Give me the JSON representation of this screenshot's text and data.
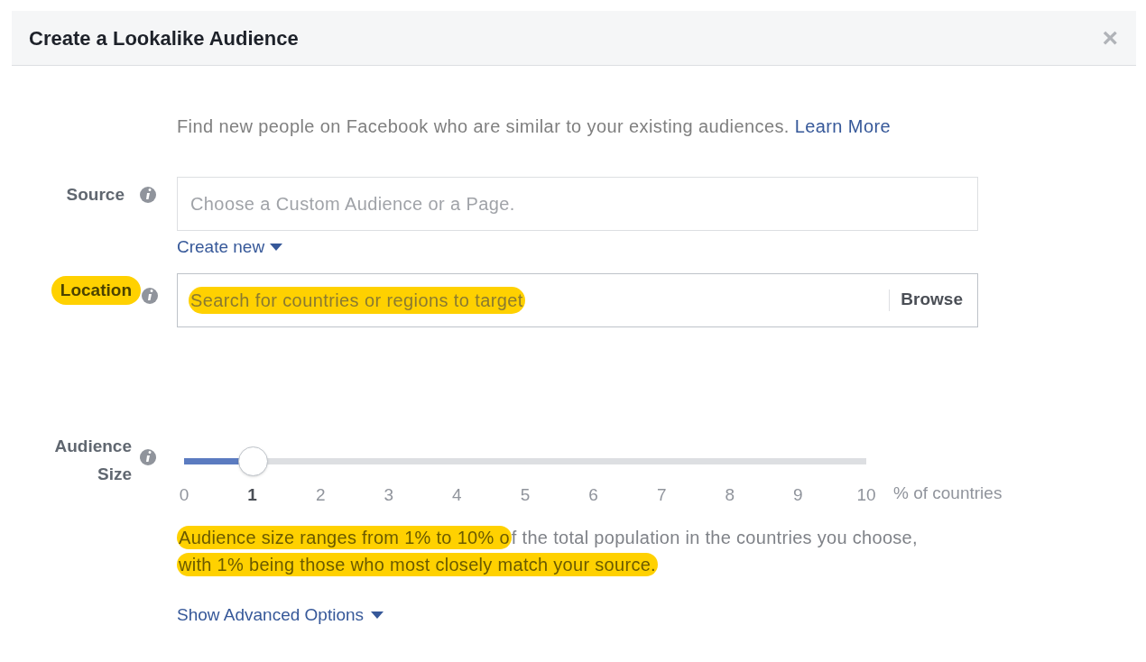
{
  "dialog": {
    "title": "Create a Lookalike Audience",
    "close": "×"
  },
  "intro": {
    "text": "Find new people on Facebook who are similar to your existing audiences.",
    "link": "Learn More"
  },
  "source": {
    "label": "Source",
    "highlighted": false,
    "placeholder": "Choose a Custom Audience or a Page.",
    "create_new": "Create new"
  },
  "location": {
    "label": "Location",
    "highlighted": true,
    "placeholder": "Search for countries or regions to target",
    "placeholder_highlighted": true,
    "browse": "Browse"
  },
  "audience_size": {
    "label_lines": [
      "Audience",
      "Size"
    ],
    "level": 0.1,
    "ticks": [
      {
        "label": "0",
        "selected": false
      },
      {
        "label": "1",
        "selected": true
      },
      {
        "label": "2",
        "selected": false
      },
      {
        "label": "3",
        "selected": false
      },
      {
        "label": "4",
        "selected": false
      },
      {
        "label": "5",
        "selected": false
      },
      {
        "label": "6",
        "selected": false
      },
      {
        "label": "7",
        "selected": false
      },
      {
        "label": "8",
        "selected": false
      },
      {
        "label": "9",
        "selected": false
      },
      {
        "label": "10",
        "selected": false
      }
    ],
    "unit": "% of countries",
    "description_lines": [
      [
        {
          "text": "Audience size ranges from 1% to 10% o",
          "highlighted": true
        },
        {
          "text": "f the total population in the countries you choose,",
          "highlighted": false
        }
      ],
      [
        {
          "text": "with 1% being those who most closely match your source.",
          "highlighted": true
        }
      ]
    ]
  },
  "advanced": {
    "label": "Show Advanced Options"
  }
}
